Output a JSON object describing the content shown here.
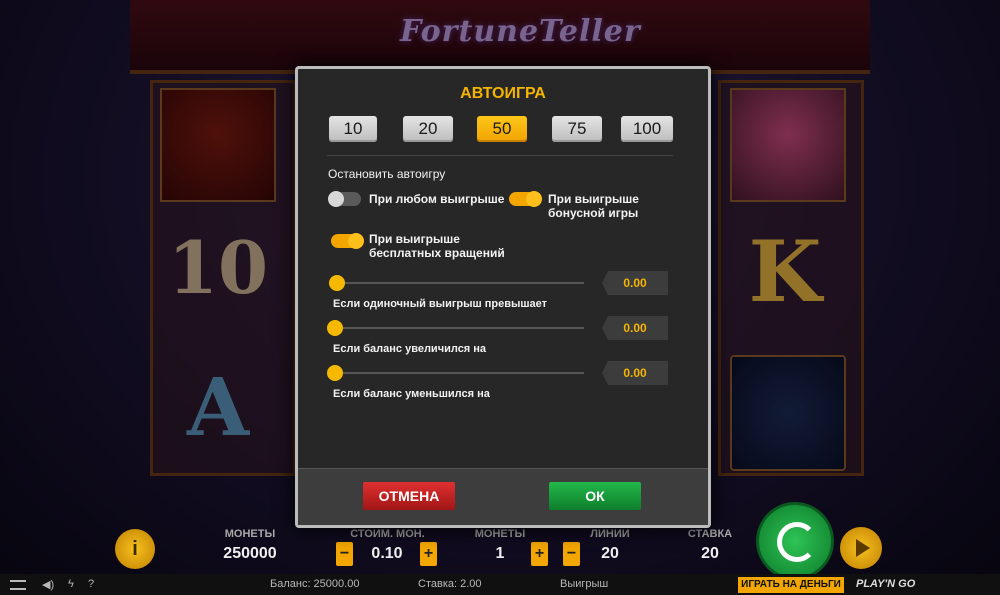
{
  "game": {
    "logo": "FortuneTeller"
  },
  "reel_symbols": {
    "left_mid": "10",
    "left_bot": "A",
    "right_mid": "K"
  },
  "modal": {
    "title": "АВТОИГРА",
    "counts": [
      "10",
      "20",
      "50",
      "75",
      "100"
    ],
    "selected_count": "50",
    "stop_heading": "Остановить автоигру",
    "toggles": [
      {
        "label": "При любом выигрыше",
        "on": false
      },
      {
        "label_line1": "При выигрыше",
        "label_line2": "бонусной игры",
        "on": true
      },
      {
        "label_line1": "При выигрыше",
        "label_line2": "бесплатных вращений",
        "on": true
      }
    ],
    "sliders": [
      {
        "label": "Если одиночный выигрыш превышает",
        "value": "0.00",
        "level": 0
      },
      {
        "label": "Если баланс увеличился на",
        "value": "0.00",
        "level": 0
      },
      {
        "label": "Если баланс уменьшился на",
        "value": "0.00",
        "level": 0
      }
    ],
    "cancel_label": "ОТМЕНА",
    "ok_label": "ОК"
  },
  "hud": {
    "coins_label": "МОНЕТЫ",
    "coins_value": "250000",
    "coin_value_label": "СТОИМ. МОН.",
    "coin_value": "0.10",
    "bet_coins_label": "МОНЕТЫ",
    "bet_coins_value": "1",
    "lines_label": "ЛИНИИ",
    "lines_value": "20",
    "bet_label": "СТАВКА",
    "bet_value": "20",
    "minus": "−",
    "plus": "+",
    "info_glyph": "i"
  },
  "bottom_bar": {
    "balance": "Баланс: 25000.00",
    "stake": "Ставка: 2.00",
    "win": "Выигрыш",
    "real_money_button": "ИГРАТЬ НА ДЕНЬГИ",
    "brand": "PLAY'N GO",
    "help": "?"
  },
  "colors": {
    "accent": "#f4b400",
    "cancel": "#c62020",
    "ok": "#1a9e3c",
    "panel": "#272727"
  }
}
